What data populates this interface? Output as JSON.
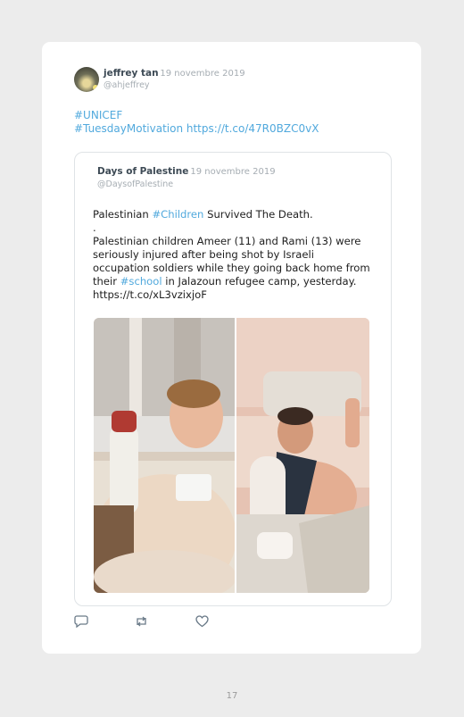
{
  "tweet": {
    "author_name": "jeffrey tan",
    "author_handle": "@ahjeffrey",
    "date": "19 novembre 2019",
    "separator": "·",
    "lines": [
      "#UNICEF",
      "#TuesdayMotivation https://t.co/47R0BZC0vX"
    ]
  },
  "quoted": {
    "author_name": "Days of Palestine",
    "author_handle": "@DaysofPalestine",
    "date": "19 novembre 2019",
    "separator": "·",
    "line1_pre": "Palestinian ",
    "line1_tag": "#Children",
    "line1_post": " Survived The Death.",
    "dot_line": ".",
    "body_lines": [
      "Palestinian children Ameer (11) and Rami (13) were",
      "seriously injured after being shot by Israeli",
      "occupation soldiers while they going back home from"
    ],
    "line_school_pre": "their ",
    "line_school_tag": "#school",
    "line_school_post": " in Jalazoun refugee camp, yesterday.",
    "link": "https://t.co/xL3vzixjoF"
  },
  "actions": {
    "reply_icon": "reply-icon",
    "retweet_icon": "retweet-icon",
    "like_icon": "heart-icon"
  },
  "page_number": "17"
}
